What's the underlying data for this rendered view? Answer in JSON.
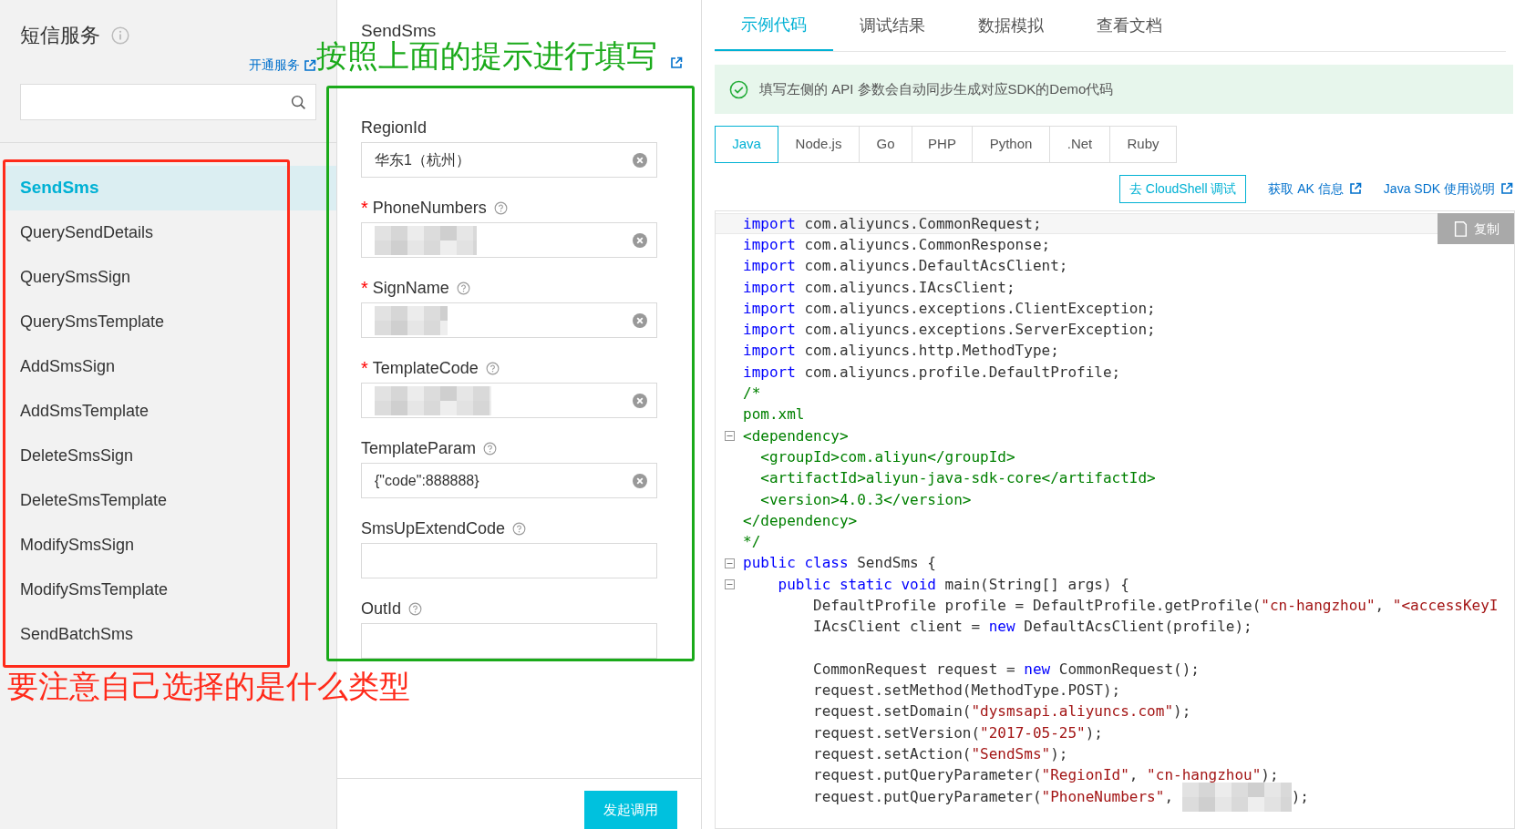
{
  "sidebar": {
    "title": "短信服务",
    "open_service_link": "开通服务",
    "items": [
      {
        "label": "SendSms",
        "selected": true
      },
      {
        "label": "QuerySendDetails",
        "selected": false
      },
      {
        "label": "QuerySmsSign",
        "selected": false
      },
      {
        "label": "QuerySmsTemplate",
        "selected": false
      },
      {
        "label": "AddSmsSign",
        "selected": false
      },
      {
        "label": "AddSmsTemplate",
        "selected": false
      },
      {
        "label": "DeleteSmsSign",
        "selected": false
      },
      {
        "label": "DeleteSmsTemplate",
        "selected": false
      },
      {
        "label": "ModifySmsSign",
        "selected": false
      },
      {
        "label": "ModifySmsTemplate",
        "selected": false
      },
      {
        "label": "SendBatchSms",
        "selected": false
      }
    ]
  },
  "form": {
    "title": "SendSms",
    "fields": [
      {
        "label": "RegionId",
        "help": false,
        "value": "华东1（杭州）",
        "redacted": false,
        "clearable": true
      },
      {
        "required_mark": "*",
        "label": "PhoneNumbers",
        "help": true,
        "redacted": true,
        "clearable": true
      },
      {
        "required_mark": "*",
        "label": "SignName",
        "help": true,
        "redacted": true,
        "clearable": true
      },
      {
        "required_mark": "*",
        "label": "TemplateCode",
        "help": true,
        "redacted": true,
        "clearable": true
      },
      {
        "label": "TemplateParam",
        "help": true,
        "value": "{\"code\":888888}",
        "redacted": false,
        "clearable": true
      },
      {
        "label": "SmsUpExtendCode",
        "help": true,
        "redacted": false,
        "clearable": false
      },
      {
        "label": "OutId",
        "help": true,
        "redacted": false,
        "clearable": false
      }
    ],
    "submit": "发起调用"
  },
  "annotations": [
    {
      "kind": "sidebar",
      "text": "要注意自己选择的是什么类型",
      "color": "#ff2a1a"
    },
    {
      "kind": "form",
      "text": "按照上面的提示进行填写",
      "color": "#1aaa1a"
    }
  ],
  "tabs": [
    {
      "label": "示例代码",
      "selected": true
    },
    {
      "label": "调试结果",
      "selected": false
    },
    {
      "label": "数据模拟",
      "selected": false
    },
    {
      "label": "查看文档",
      "selected": false
    }
  ],
  "notice": "填写左侧的 API 参数会自动同步生成对应SDK的Demo代码",
  "languages": [
    {
      "label": "Java",
      "selected": true
    },
    {
      "label": "Node.js",
      "selected": false
    },
    {
      "label": "Go",
      "selected": false
    },
    {
      "label": "PHP",
      "selected": false
    },
    {
      "label": "Python",
      "selected": false
    },
    {
      "label": ".Net",
      "selected": false
    },
    {
      "label": "Ruby",
      "selected": false
    }
  ],
  "actions": {
    "cloudshell": "去 CloudShell 调试",
    "links": [
      "获取 AK 信息",
      "Java SDK 使用说明"
    ]
  },
  "copy_button": "复制",
  "code": [
    {
      "tokens": [
        {
          "kind": "keyword",
          "text": "import"
        },
        {
          "kind": "plain",
          "text": " com.aliyuncs.CommonRequest;"
        }
      ]
    },
    {
      "tokens": [
        {
          "kind": "keyword",
          "text": "import"
        },
        {
          "kind": "plain",
          "text": " com.aliyuncs.CommonResponse;"
        }
      ]
    },
    {
      "tokens": [
        {
          "kind": "keyword",
          "text": "import"
        },
        {
          "kind": "plain",
          "text": " com.aliyuncs.DefaultAcsClient;"
        }
      ]
    },
    {
      "tokens": [
        {
          "kind": "keyword",
          "text": "import"
        },
        {
          "kind": "plain",
          "text": " com.aliyuncs.IAcsClient;"
        }
      ]
    },
    {
      "tokens": [
        {
          "kind": "keyword",
          "text": "import"
        },
        {
          "kind": "plain",
          "text": " com.aliyuncs.exceptions.ClientException;"
        }
      ]
    },
    {
      "tokens": [
        {
          "kind": "keyword",
          "text": "import"
        },
        {
          "kind": "plain",
          "text": " com.aliyuncs.exceptions.ServerException;"
        }
      ]
    },
    {
      "tokens": [
        {
          "kind": "keyword",
          "text": "import"
        },
        {
          "kind": "plain",
          "text": " com.aliyuncs.http.MethodType;"
        }
      ]
    },
    {
      "tokens": [
        {
          "kind": "keyword",
          "text": "import"
        },
        {
          "kind": "plain",
          "text": " com.aliyuncs.profile.DefaultProfile;"
        }
      ]
    },
    {
      "tokens": [
        {
          "kind": "comment",
          "text": "/*"
        }
      ]
    },
    {
      "tokens": [
        {
          "kind": "comment",
          "text": "pom.xml"
        }
      ]
    },
    {
      "fold": true,
      "tokens": [
        {
          "kind": "comment",
          "text": "<dependency>"
        }
      ]
    },
    {
      "tokens": [
        {
          "kind": "comment",
          "text": "  <groupId>com.aliyun</groupId>"
        }
      ]
    },
    {
      "tokens": [
        {
          "kind": "comment",
          "text": "  <artifactId>aliyun-java-sdk-core</artifactId>"
        }
      ]
    },
    {
      "tokens": [
        {
          "kind": "comment",
          "text": "  <version>4.0.3</version>"
        }
      ]
    },
    {
      "tokens": [
        {
          "kind": "comment",
          "text": "</dependency>"
        }
      ]
    },
    {
      "tokens": [
        {
          "kind": "comment",
          "text": "*/"
        }
      ]
    },
    {
      "fold": true,
      "tokens": [
        {
          "kind": "keyword",
          "text": "public class"
        },
        {
          "kind": "plain",
          "text": " SendSms {"
        }
      ]
    },
    {
      "fold": true,
      "tokens": [
        {
          "kind": "keyword",
          "text": "    public static void"
        },
        {
          "kind": "plain",
          "text": " main(String[] args) {"
        }
      ]
    },
    {
      "tokens": [
        {
          "kind": "plain",
          "text": "        DefaultProfile profile = DefaultProfile.getProfile("
        },
        {
          "kind": "string",
          "text": "\"cn-hangzhou\""
        },
        {
          "kind": "plain",
          "text": ", "
        },
        {
          "kind": "string",
          "text": "\"<accessKeyI"
        }
      ]
    },
    {
      "tokens": [
        {
          "kind": "plain",
          "text": "        IAcsClient client = "
        },
        {
          "kind": "keyword",
          "text": "new"
        },
        {
          "kind": "plain",
          "text": " DefaultAcsClient(profile);"
        }
      ]
    },
    {
      "blank": true
    },
    {
      "tokens": [
        {
          "kind": "plain",
          "text": "        CommonRequest request = "
        },
        {
          "kind": "keyword",
          "text": "new"
        },
        {
          "kind": "plain",
          "text": " CommonRequest();"
        }
      ]
    },
    {
      "tokens": [
        {
          "kind": "plain",
          "text": "        request.setMethod(MethodType.POST);"
        }
      ]
    },
    {
      "tokens": [
        {
          "kind": "plain",
          "text": "        request.setDomain("
        },
        {
          "kind": "string",
          "text": "\"dysmsapi.aliyuncs.com\""
        },
        {
          "kind": "plain",
          "text": ");"
        }
      ]
    },
    {
      "tokens": [
        {
          "kind": "plain",
          "text": "        request.setVersion("
        },
        {
          "kind": "string",
          "text": "\"2017-05-25\""
        },
        {
          "kind": "plain",
          "text": ");"
        }
      ]
    },
    {
      "tokens": [
        {
          "kind": "plain",
          "text": "        request.setAction("
        },
        {
          "kind": "string",
          "text": "\"SendSms\""
        },
        {
          "kind": "plain",
          "text": ");"
        }
      ]
    },
    {
      "tokens": [
        {
          "kind": "plain",
          "text": "        request.putQueryParameter("
        },
        {
          "kind": "string",
          "text": "\"RegionId\""
        },
        {
          "kind": "plain",
          "text": ", "
        },
        {
          "kind": "string",
          "text": "\"cn-hangzhou\""
        },
        {
          "kind": "plain",
          "text": ");"
        }
      ]
    },
    {
      "tokens": [
        {
          "kind": "plain",
          "text": "        request.putQueryParameter("
        },
        {
          "kind": "string",
          "text": "\"PhoneNumbers\""
        },
        {
          "kind": "plain",
          "text": ", "
        },
        {
          "kind": "redacted"
        },
        {
          "kind": "plain",
          "text": ");"
        }
      ]
    }
  ]
}
